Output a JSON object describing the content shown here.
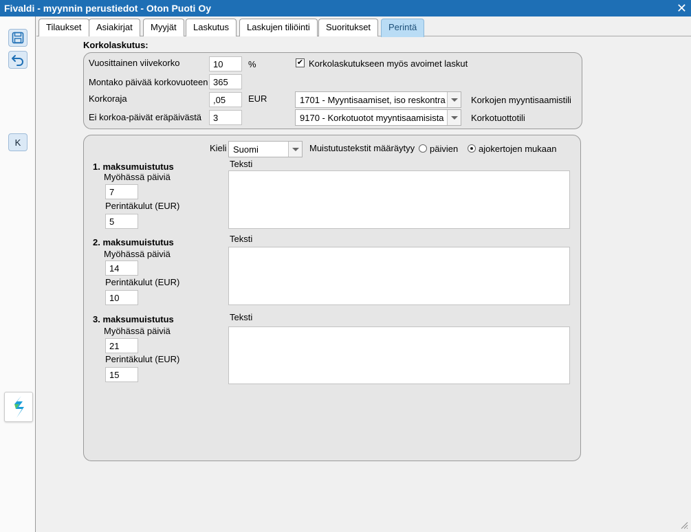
{
  "window": {
    "title": "Fivaldi - myynnin perustiedot - Oton Puoti Oy",
    "close_glyph": "✕"
  },
  "sidebar": {
    "save_icon": "save-icon",
    "undo_icon": "undo-icon",
    "k_label": "K",
    "logo_icon": "fivaldi-logo-icon"
  },
  "tabs": [
    {
      "label": "Tilaukset"
    },
    {
      "label": "Asiakirjat"
    },
    {
      "label": "Myyjät"
    },
    {
      "label": "Laskutus"
    },
    {
      "label": "Laskujen tiliöinti"
    },
    {
      "label": "Suoritukset"
    },
    {
      "label": "Perintä",
      "active": true
    }
  ],
  "interest": {
    "section_title": "Korkolaskutus:",
    "annual_rate_label": "Vuosittainen viivekorko",
    "annual_rate_value": "10",
    "annual_rate_unit": "%",
    "days_label": "Montako päivää korkovuoteen",
    "days_value": "365",
    "limit_label": "Korkoraja",
    "limit_value": ",05",
    "limit_unit": "EUR",
    "no_interest_label": "Ei korkoa-päivät eräpäivästä",
    "no_interest_value": "3",
    "open_invoices_label": "Korkolaskutukseen myös avoimet laskut",
    "open_invoices_checked": true,
    "receivables_account_value": "1701 - Myyntisaamiset, iso reskontra",
    "receivables_account_label": "Korkojen myyntisaamistili",
    "income_account_value": "9170 - Korkotuotot myyntisaamisista",
    "income_account_label": "Korkotuottotili"
  },
  "reminders": {
    "language_label": "Kieli",
    "language_value": "Suomi",
    "rule_label": "Muistutustekstit määräytyy",
    "rule_option_days": "päivien",
    "rule_option_runs": "ajokertojen mukaan",
    "rule_selected": "ajokertojen mukaan",
    "items": [
      {
        "title": "1. maksumuistutus",
        "late_days_label": "Myöhässä päiviä",
        "late_days_value": "7",
        "fee_label": "Perintäkulut (EUR)",
        "fee_value": "5",
        "text_label": "Teksti",
        "text_value": ""
      },
      {
        "title": "2. maksumuistutus",
        "late_days_label": "Myöhässä päiviä",
        "late_days_value": "14",
        "fee_label": "Perintäkulut (EUR)",
        "fee_value": "10",
        "text_label": "Teksti",
        "text_value": ""
      },
      {
        "title": "3. maksumuistutus",
        "late_days_label": "Myöhässä päiviä",
        "late_days_value": "21",
        "fee_label": "Perintäkulut (EUR)",
        "fee_value": "15",
        "text_label": "Teksti",
        "text_value": ""
      }
    ]
  },
  "colors": {
    "titlebar": "#1e6fb5",
    "active_tab": "#b9dcf5",
    "panel": "#e6e6e6"
  }
}
